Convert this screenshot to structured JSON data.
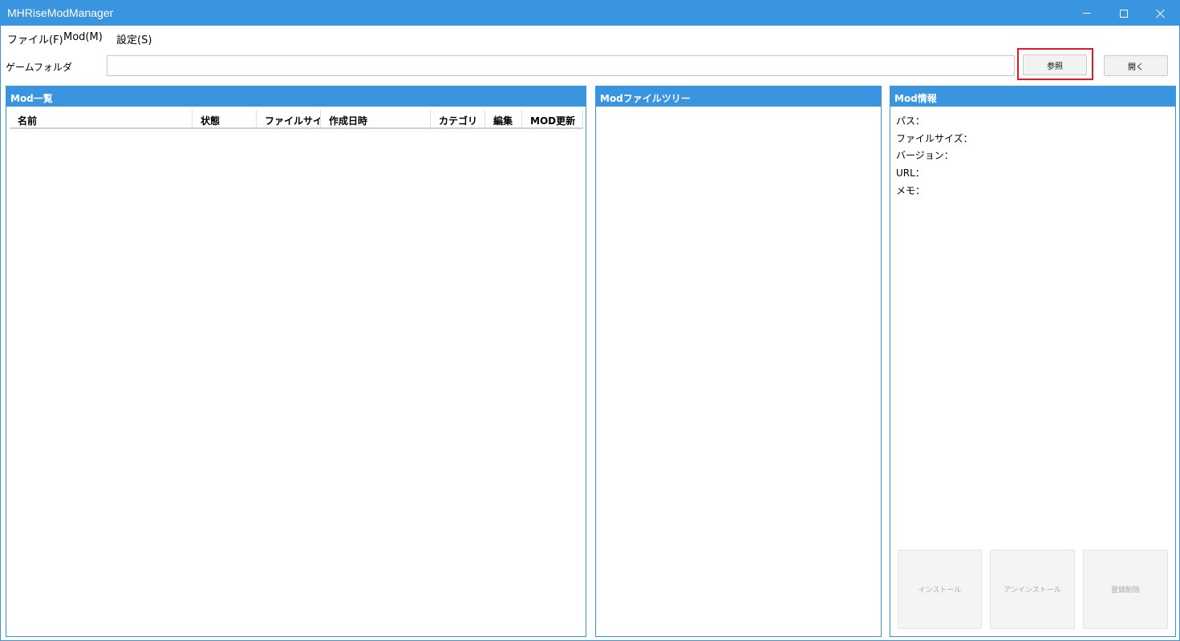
{
  "window": {
    "title": "MHRiseModManager"
  },
  "menu": {
    "file": "ファイル(F)",
    "mod": "Mod(M)",
    "settings": "設定(S)"
  },
  "folder": {
    "label": "ゲームフォルダ",
    "value": "",
    "browse_label": "参照",
    "open_label": "開く"
  },
  "mod_list": {
    "title": "Mod一覧",
    "columns": [
      "名前",
      "状態",
      "ファイルサイズ",
      "作成日時",
      "カテゴリ",
      "編集",
      "MOD更新"
    ]
  },
  "mod_tree": {
    "title": "Modファイルツリー"
  },
  "mod_info": {
    "title": "Mod情報",
    "path_label": "パス：",
    "size_label": "ファイルサイズ：",
    "version_label": "バージョン：",
    "url_label": "URL：",
    "memo_label": "メモ：",
    "install_label": "インストール",
    "uninstall_label": "アンインストール",
    "delete_label": "登録削除"
  },
  "colors": {
    "accent": "#3a95e0",
    "highlight": "#e01b24"
  }
}
